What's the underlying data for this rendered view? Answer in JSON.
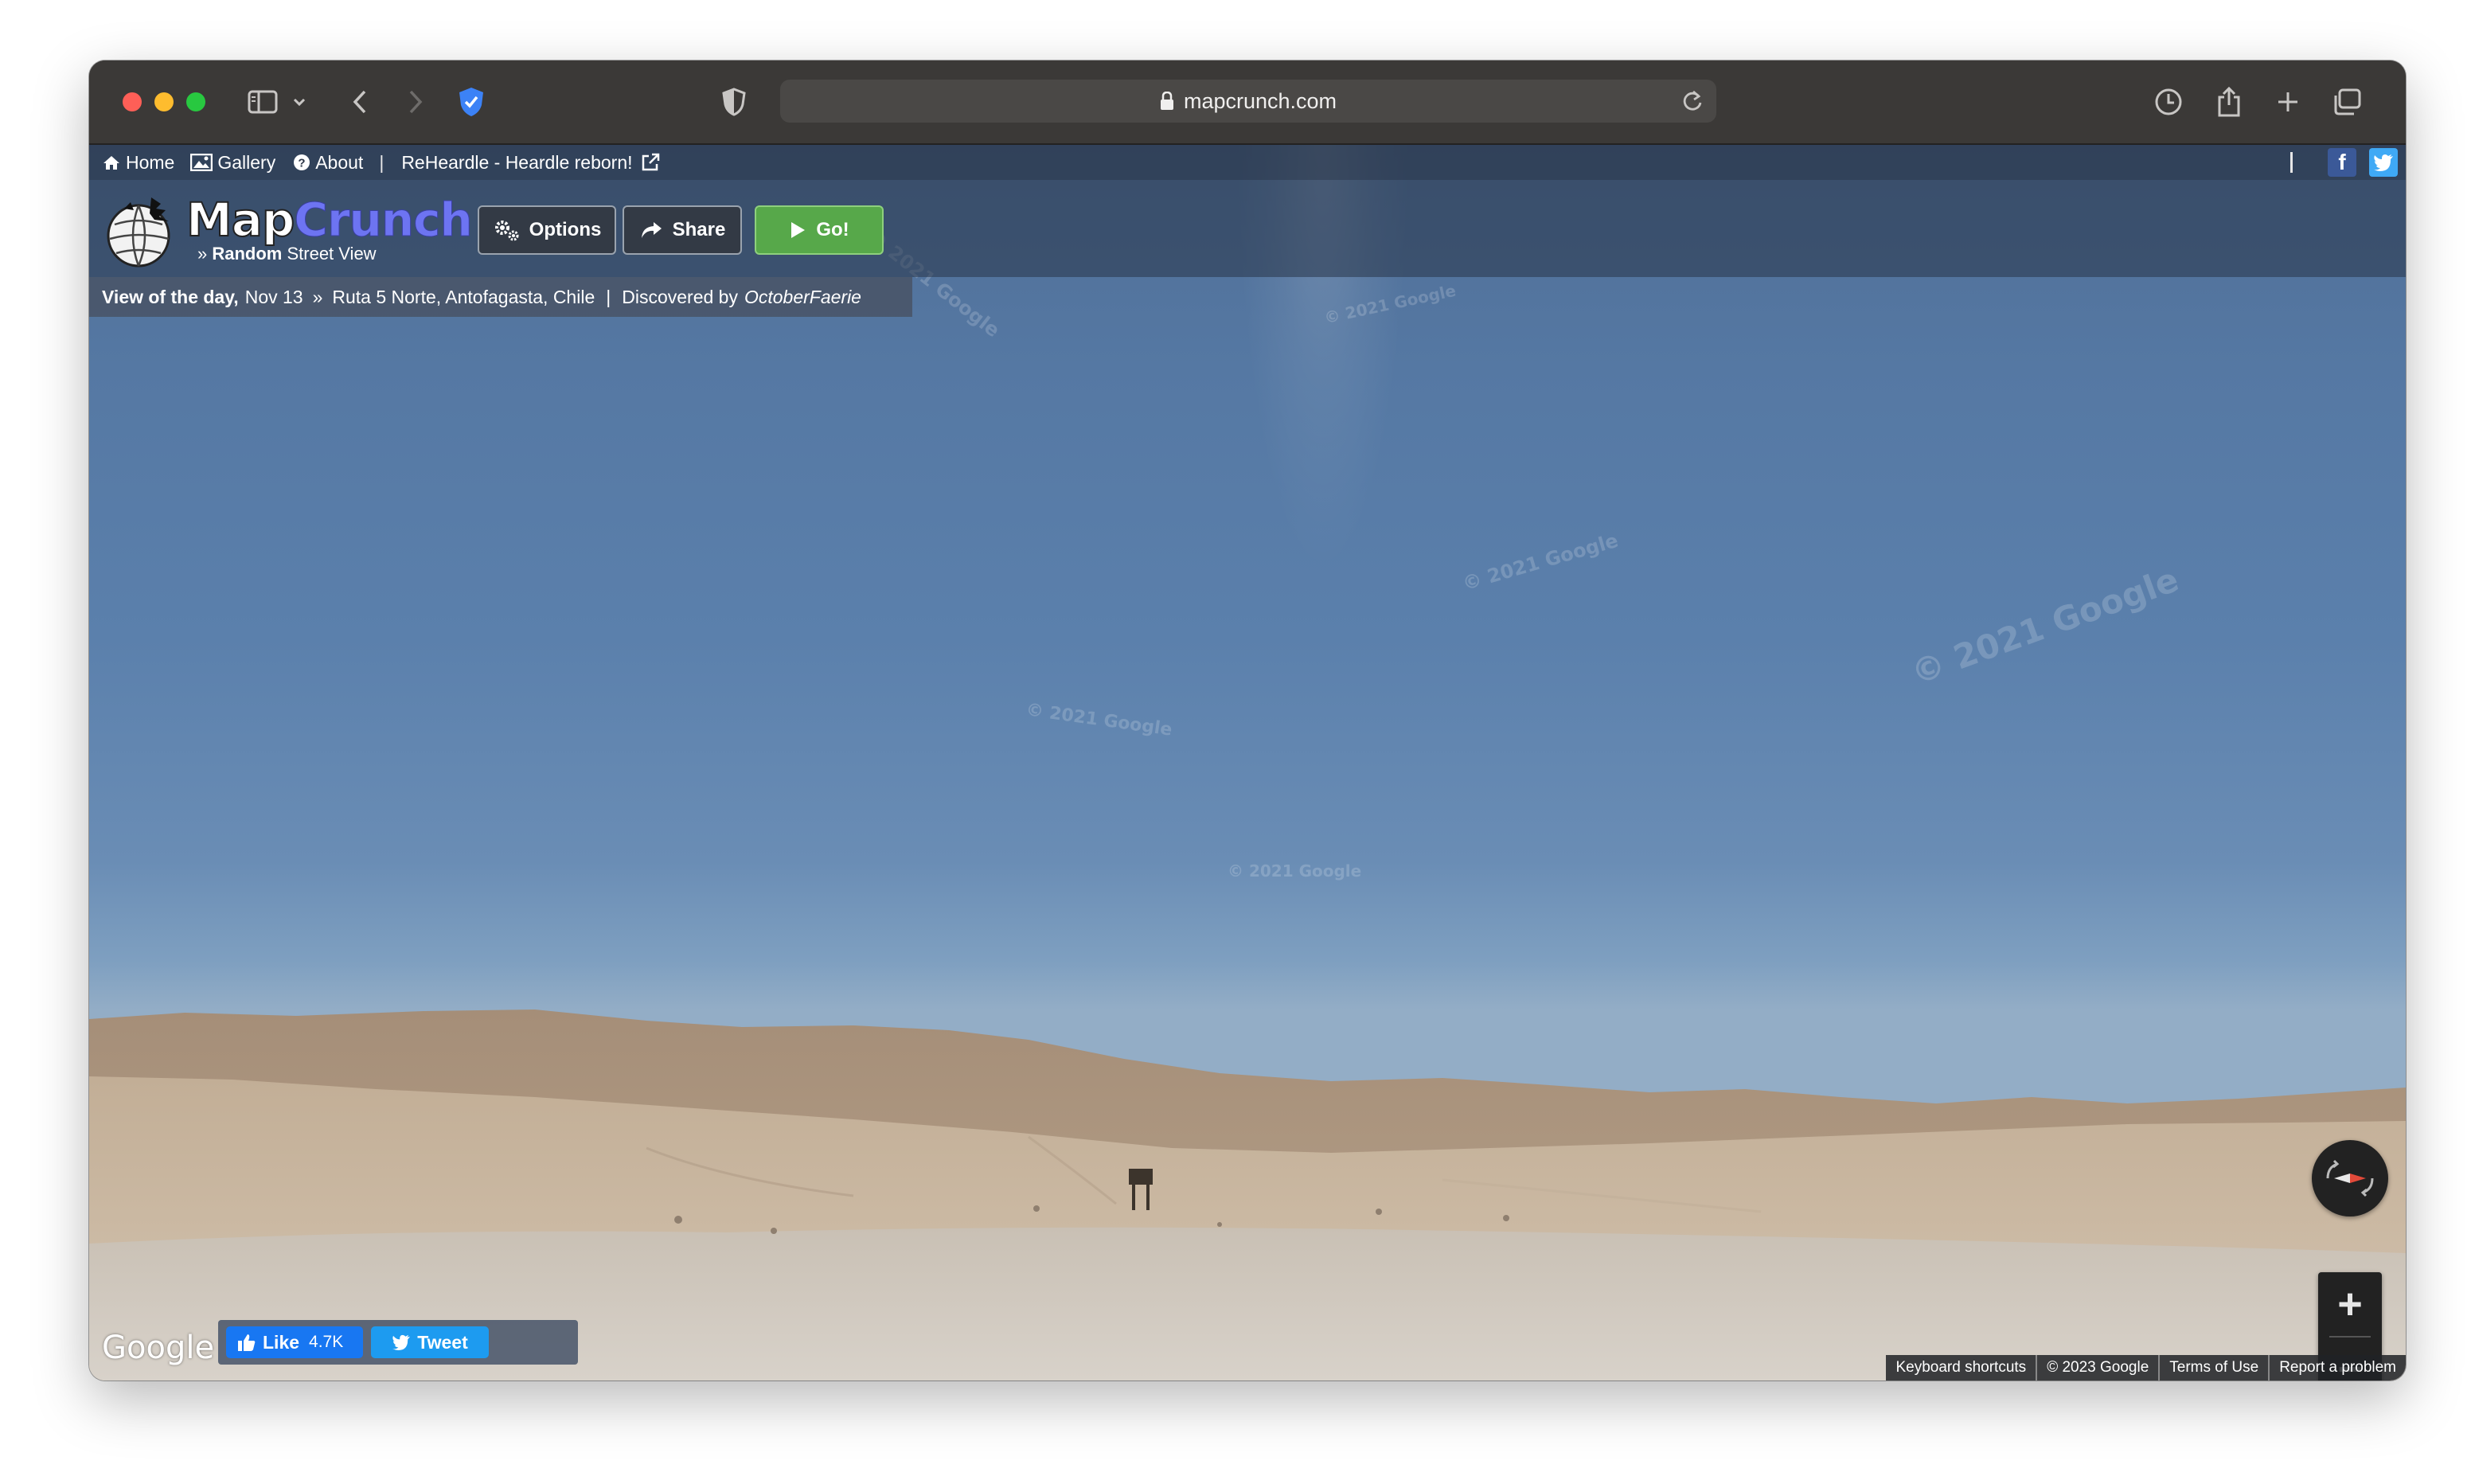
{
  "browser": {
    "url": "mapcrunch.com"
  },
  "nav": {
    "home": "Home",
    "gallery": "Gallery",
    "about": "About",
    "separator": "|",
    "promo": "ReHeardle - Heardle reborn!",
    "right_separator": "|"
  },
  "logo": {
    "map": "Map",
    "crunch": "Crunch",
    "tagline_prefix": "» ",
    "tagline_bold": "Random",
    "tagline_rest": " Street View"
  },
  "buttons": {
    "options": "Options",
    "share": "Share",
    "go": "Go!"
  },
  "caption": {
    "lead": "View of the day,",
    "date": "Nov 13",
    "raquo": "»",
    "location": "Ruta 5 Norte, Antofagasta, Chile",
    "bar": "|",
    "discovered": "Discovered by",
    "discoverer": "OctoberFaerie"
  },
  "watermarks": [
    "© 2021 Google",
    "© 2021 Google",
    "© 2021 Google",
    "© 2021 Google",
    "© 2021 Google",
    "© 2021 Google"
  ],
  "map_controls": {
    "zoom_in": "+",
    "zoom_out": "−"
  },
  "footer": {
    "google": "Google",
    "like": "Like",
    "like_count": "4.7K",
    "tweet": "Tweet",
    "keyboard_shortcuts": "Keyboard shortcuts",
    "copyright": "© 2023 Google",
    "terms": "Terms of Use",
    "report": "Report a problem"
  },
  "colors": {
    "go_button": "#57a84a",
    "crunch_wordmark": "#6d74f2",
    "facebook": "#3b5998",
    "twitter": "#3fa9f5"
  }
}
